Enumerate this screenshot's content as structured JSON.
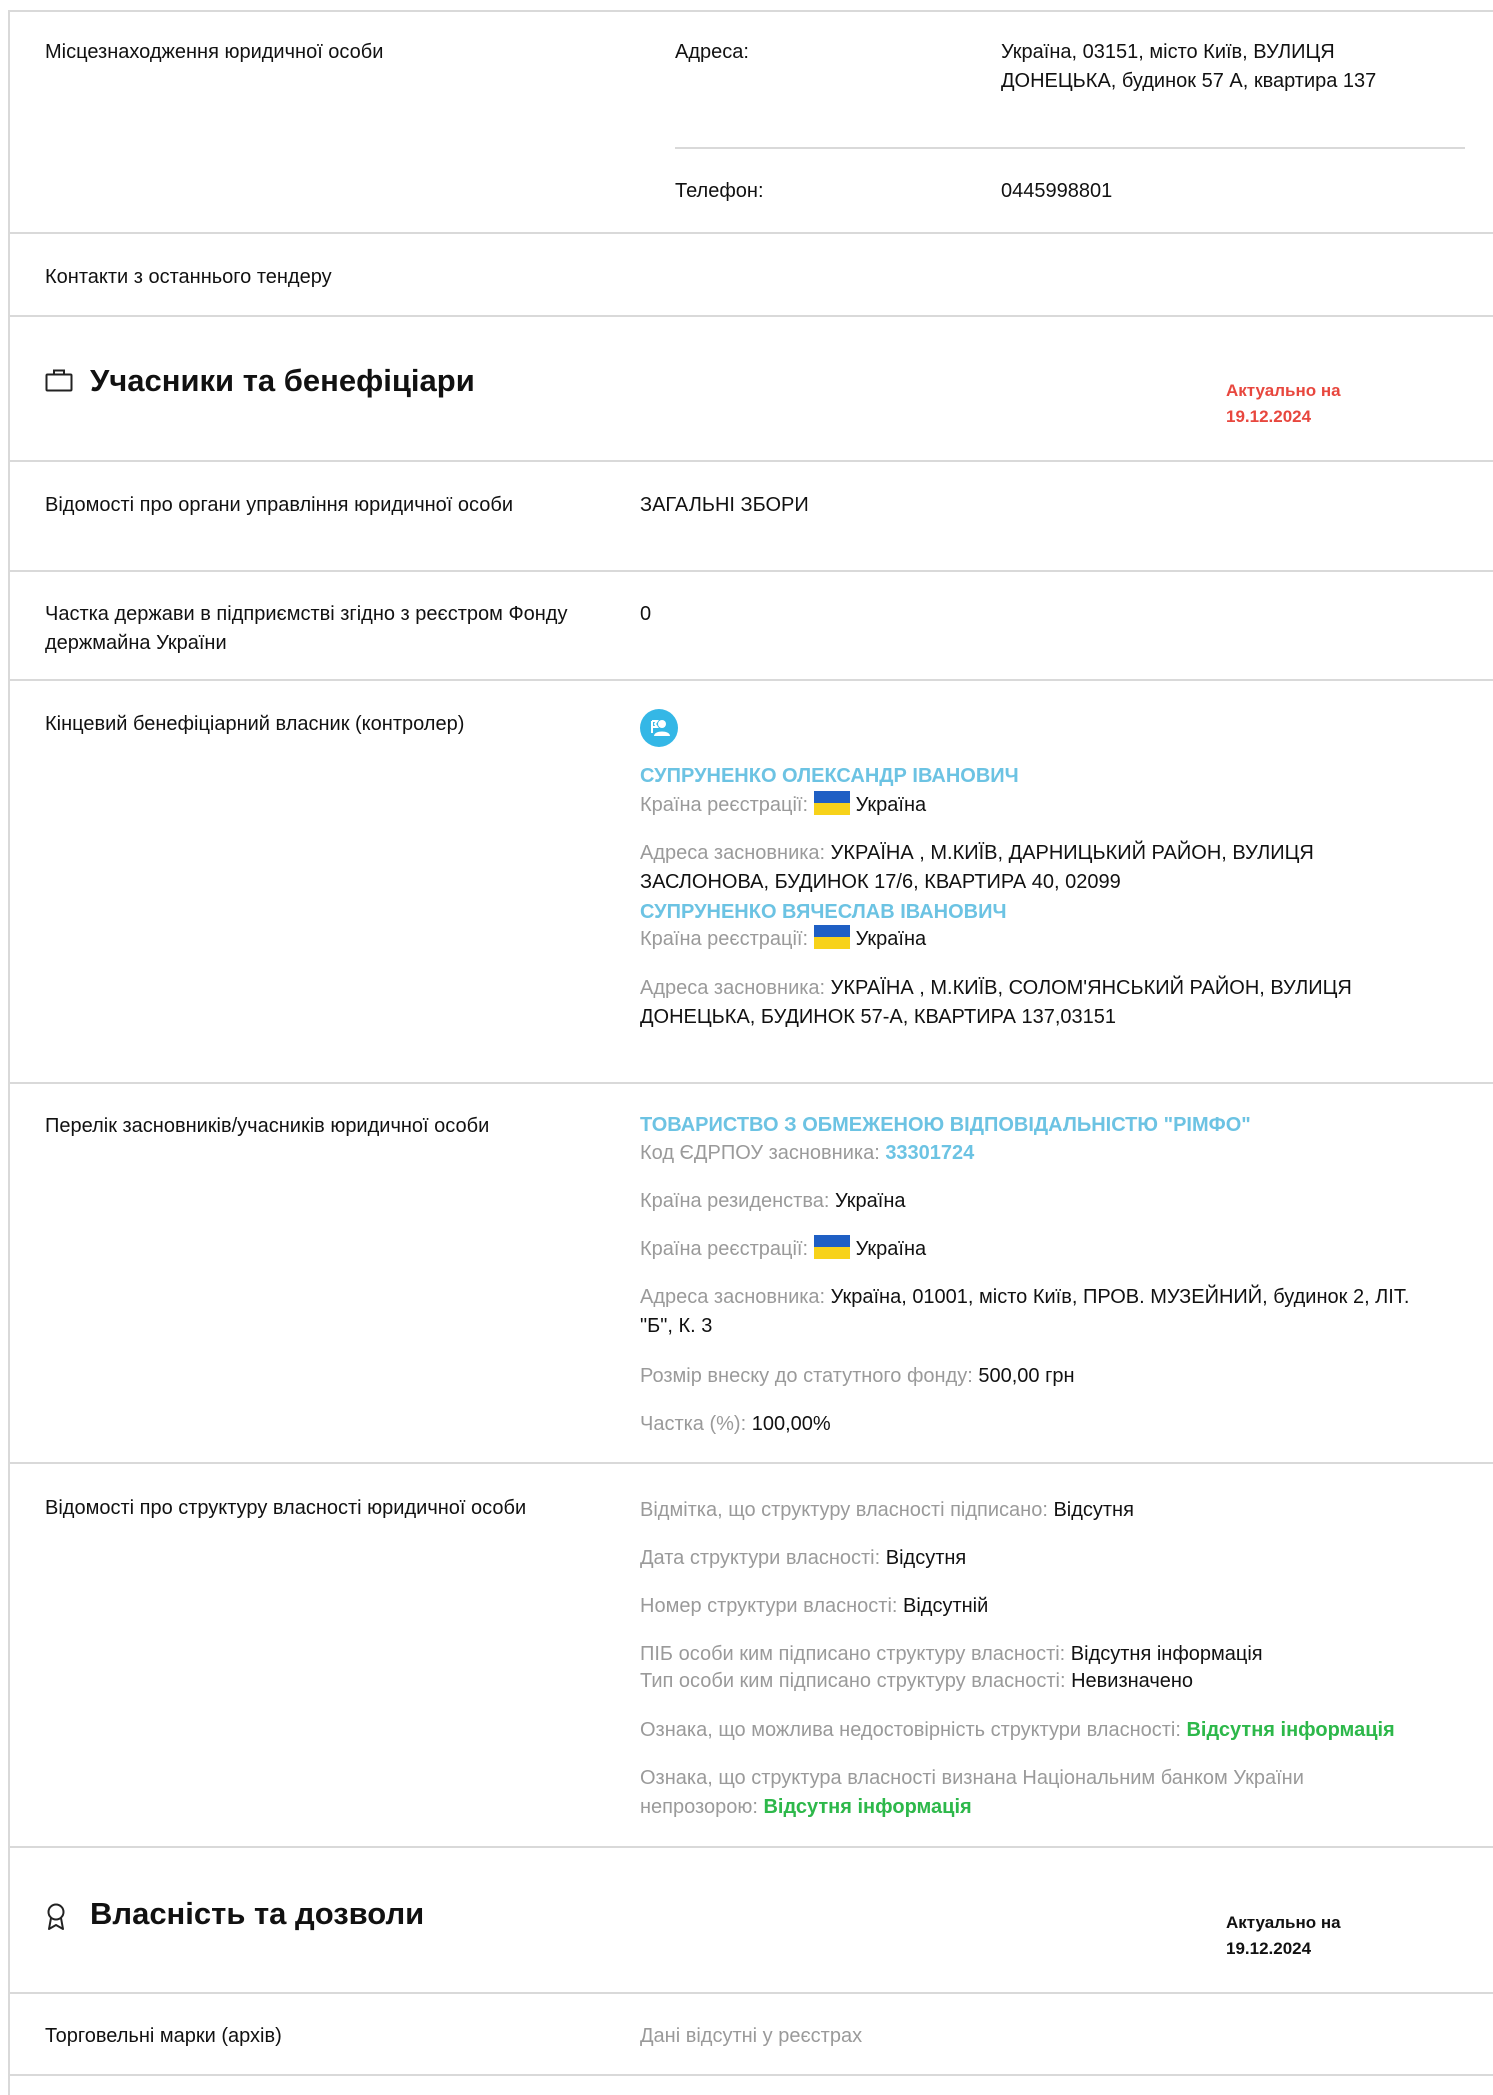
{
  "location": {
    "label": "Місцезнаходження юридичної особи",
    "address_label": "Адреса:",
    "address_value": "Україна, 03151, місто Київ, ВУЛИЦЯ ДОНЕЦЬКА, будинок 57 А, квартира 137",
    "phone_label": "Телефон:",
    "phone_value": "0445998801"
  },
  "contacts_label": "Контакти з останнього тендеру",
  "participants": {
    "title": "Учасники та бенефіціари",
    "actual_label": "Актуально на",
    "actual_date": "19.12.2024",
    "actual_color": "#e8473e",
    "governance": {
      "label": "Відомості про органи управління юридичної особи",
      "value": "ЗАГАЛЬНІ ЗБОРИ"
    },
    "state_share": {
      "label": "Частка держави в підприємстві згідно з реєстром Фонду держмайна України",
      "value": "0"
    },
    "beneficiaries": {
      "label": "Кінцевий бенефіціарний власник (контролер)",
      "icon": "person-icon",
      "items": [
        {
          "name": "СУПРУНЕНКО ОЛЕКСАНДР ІВАНОВИЧ",
          "country_label": "Країна реєстрації:",
          "country": "Україна",
          "address_label": "Адреса засновника:",
          "address": "УКРАЇНА , М.КИЇВ, ДАРНИЦЬКИЙ РАЙОН, ВУЛИЦЯ ЗАСЛОНОВА, БУДИНОК 17/6, КВАРТИРА 40, 02099"
        },
        {
          "name": "СУПРУНЕНКО ВЯЧЕСЛАВ ІВАНОВИЧ",
          "country_label": "Країна реєстрації:",
          "country": "Україна",
          "address_label": "Адреса засновника:",
          "address": "УКРАЇНА , М.КИЇВ, СОЛОМ'ЯНСЬКИЙ РАЙОН, ВУЛИЦЯ ДОНЕЦЬКА, БУДИНОК 57-А, КВАРТИРА 137,03151"
        }
      ]
    },
    "founders": {
      "label": "Перелік засновників/учасників юридичної особи",
      "name": "ТОВАРИСТВО З ОБМЕЖЕНОЮ ВІДПОВІДАЛЬНІСТЮ \"РІМФО\"",
      "code_label": "Код ЄДРПОУ засновника:",
      "code": "33301724",
      "residence_label": "Країна резиденства:",
      "residence": "Україна",
      "country_label": "Країна реєстрації:",
      "country": "Україна",
      "address_label": "Адреса засновника:",
      "address": "Україна, 01001, місто Київ, ПРОВ. МУЗЕЙНИЙ, будинок 2, ЛІТ. \"Б\", К. 3",
      "contribution_label": "Розмір внеску до статутного фонду:",
      "contribution": "500,00 грн",
      "share_label": "Частка (%):",
      "share": "100,00%"
    },
    "ownership": {
      "label": "Відомості про структуру власності юридичної особи",
      "signed_label": "Відмітка, що структуру власності підписано:",
      "signed": "Відсутня",
      "date_label": "Дата структури власності:",
      "date": "Відсутня",
      "number_label": "Номер структури власності:",
      "number": "Відсутній",
      "signer_label": "ПІБ особи ким підписано структуру власності:",
      "signer": "Відсутня інформація",
      "signer_type_label": "Тип особи ким підписано структуру власності:",
      "signer_type": "Невизначено",
      "unreliable_label": "Ознака, що можлива недостовірність структури власності:",
      "unreliable": "Відсутня інформація",
      "opaque_label_1": "Ознака, що структура власності визнана Національним банком України",
      "opaque_label_2": "непрозорою:",
      "opaque": "Відсутня інформація"
    }
  },
  "property": {
    "title": "Власність та дозволи",
    "actual_label": "Актуально на",
    "actual_date": "19.12.2024",
    "trademarks": {
      "label": "Торговельні марки (архів)",
      "value": "Дані відсутні у реєстрах"
    }
  }
}
